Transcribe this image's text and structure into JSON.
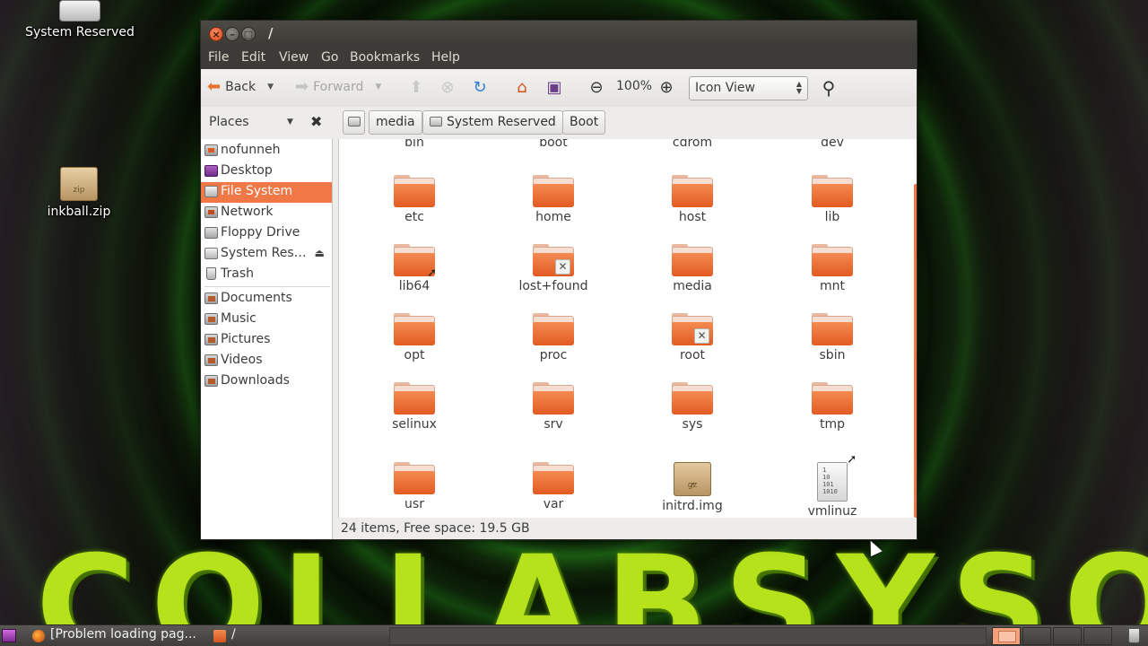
{
  "desktop": {
    "icons": [
      {
        "label": "System Reserved",
        "icon": "drive-icon"
      },
      {
        "label": "inkball.zip",
        "icon": "zip-icon",
        "badge": "zip"
      }
    ],
    "wallpaper_text": "COLLABSYSOS"
  },
  "window": {
    "title": "/",
    "menu": [
      "File",
      "Edit",
      "View",
      "Go",
      "Bookmarks",
      "Help"
    ],
    "toolbar": {
      "back_label": "Back",
      "forward_label": "Forward",
      "zoom_level": "100%",
      "view_mode": "Icon View"
    },
    "places_label": "Places",
    "breadcrumbs": [
      "media",
      "System Reserved",
      "Boot"
    ],
    "sidebar": {
      "group1": [
        {
          "label": "nofunneh",
          "icon": "home-icon"
        },
        {
          "label": "Desktop",
          "icon": "desktop-icon"
        },
        {
          "label": "File System",
          "icon": "filesystem-icon",
          "selected": true
        },
        {
          "label": "Network",
          "icon": "network-icon"
        },
        {
          "label": "Floppy Drive",
          "icon": "floppy-icon"
        },
        {
          "label": "System Res…",
          "icon": "drive-icon",
          "eject": true
        },
        {
          "label": "Trash",
          "icon": "trash-icon"
        }
      ],
      "group2": [
        {
          "label": "Documents",
          "icon": "documents-folder-icon"
        },
        {
          "label": "Music",
          "icon": "music-folder-icon"
        },
        {
          "label": "Pictures",
          "icon": "pictures-folder-icon"
        },
        {
          "label": "Videos",
          "icon": "videos-folder-icon"
        },
        {
          "label": "Downloads",
          "icon": "downloads-folder-icon"
        }
      ]
    },
    "files": [
      {
        "name": "bin",
        "type": "folder"
      },
      {
        "name": "boot",
        "type": "folder"
      },
      {
        "name": "cdrom",
        "type": "folder"
      },
      {
        "name": "dev",
        "type": "folder"
      },
      {
        "name": "etc",
        "type": "folder"
      },
      {
        "name": "home",
        "type": "folder"
      },
      {
        "name": "host",
        "type": "folder"
      },
      {
        "name": "lib",
        "type": "folder"
      },
      {
        "name": "lib64",
        "type": "folder",
        "emblem": "symlink"
      },
      {
        "name": "lost+found",
        "type": "folder",
        "emblem": "locked"
      },
      {
        "name": "media",
        "type": "folder"
      },
      {
        "name": "mnt",
        "type": "folder"
      },
      {
        "name": "opt",
        "type": "folder"
      },
      {
        "name": "proc",
        "type": "folder"
      },
      {
        "name": "root",
        "type": "folder",
        "emblem": "locked"
      },
      {
        "name": "sbin",
        "type": "folder"
      },
      {
        "name": "selinux",
        "type": "folder"
      },
      {
        "name": "srv",
        "type": "folder"
      },
      {
        "name": "sys",
        "type": "folder"
      },
      {
        "name": "tmp",
        "type": "folder"
      },
      {
        "name": "usr",
        "type": "folder"
      },
      {
        "name": "var",
        "type": "folder"
      },
      {
        "name": "initrd.img",
        "type": "archive",
        "badge": "gz",
        "emblem": "symlink"
      },
      {
        "name": "vmlinuz",
        "type": "binary",
        "badge_lines": [
          "1",
          "10",
          "101",
          "1010"
        ],
        "emblem": "symlink"
      }
    ],
    "status": "24 items, Free space: 19.5 GB"
  },
  "taskbar": {
    "tasks": [
      {
        "label": "[Problem loading pag...",
        "icon": "firefox-icon"
      },
      {
        "label": "/",
        "icon": "folder-icon"
      }
    ]
  },
  "colors": {
    "accent": "#f07746",
    "folder": "#e8672e",
    "titlebar": "#3c3b37"
  }
}
